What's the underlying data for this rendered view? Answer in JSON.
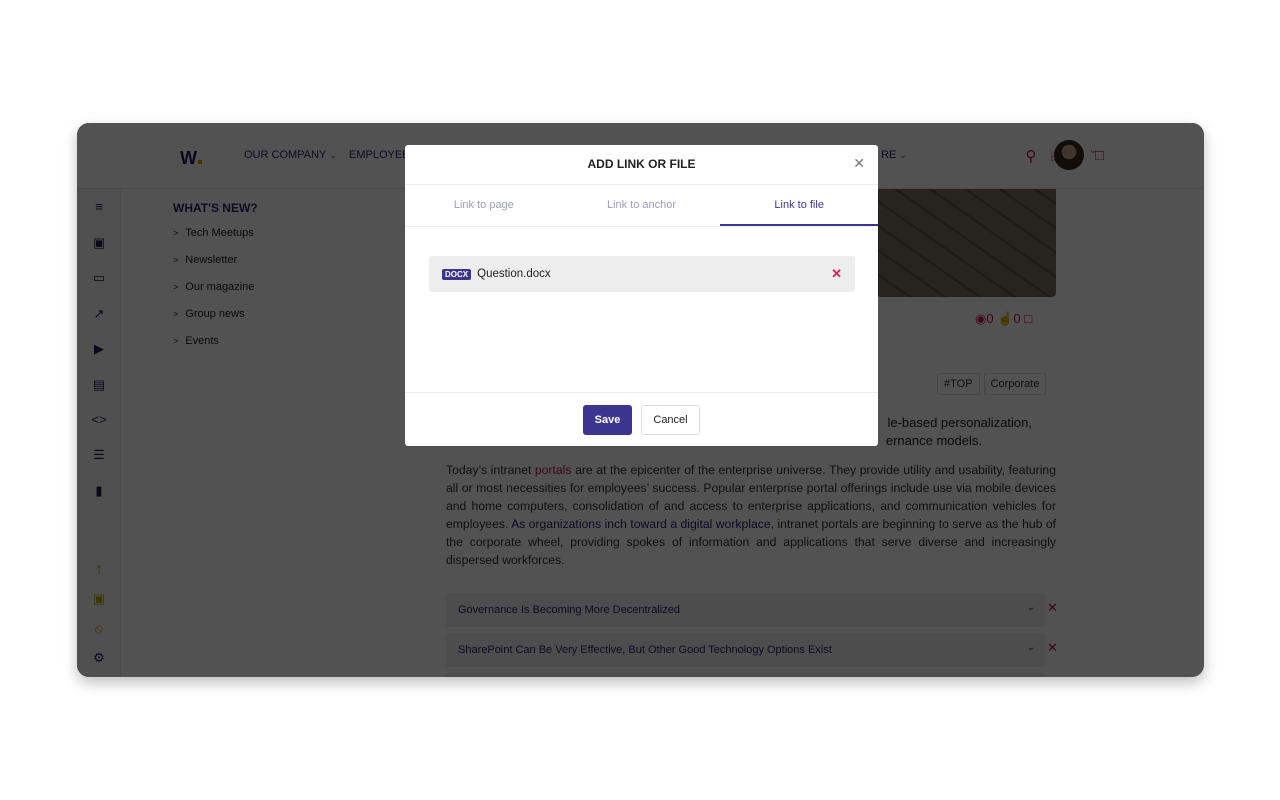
{
  "header": {
    "nav": [
      {
        "label": "OUR COMPANY"
      },
      {
        "label": "EMPLOYEE"
      },
      {
        "label": "RE"
      }
    ]
  },
  "sidebar": {
    "title": "WHAT'S NEW?",
    "items": [
      "Tech Meetups",
      "Newsletter",
      "Our magazine",
      "Group news",
      "Events"
    ]
  },
  "article": {
    "stats": {
      "views": "0",
      "likes": "0"
    },
    "tags": [
      "#TOP",
      "Corporate"
    ],
    "lead_line1": "le-based personalization,",
    "lead_line2": "ernance models.",
    "p_before": "Today’s intranet ",
    "p_link1": " portals ",
    "p_mid": " are at the epicenter of the enterprise universe. They provide utility and usability, featuring all or most necessities for employees’ success. Popular enterprise portal offerings include use via mobile devices and home computers, consolidation of and access to enterprise applications, and communication vehicles for employees. ",
    "p_link2": "As organizations inch toward a digital workplace",
    "p_after": ", intranet portals are beginning to serve as the hub of the corporate wheel, providing spokes of information and applications that serve diverse and increasingly dispersed workforces.",
    "accordions": [
      "Governance Is Becoming More Decentralized",
      "SharePoint Can Be Very Effective, But Other Good Technology Options Exist"
    ]
  },
  "modal": {
    "title": "ADD LINK OR FILE",
    "tabs": [
      "Link to page",
      "Link to anchor",
      "Link to file"
    ],
    "active_tab": "Link to file",
    "file": {
      "type": "DOCX",
      "name": "Question.docx"
    },
    "save": "Save",
    "cancel": "Cancel"
  },
  "colors": {
    "accent": "#3b3590",
    "pink": "#c8104f"
  }
}
